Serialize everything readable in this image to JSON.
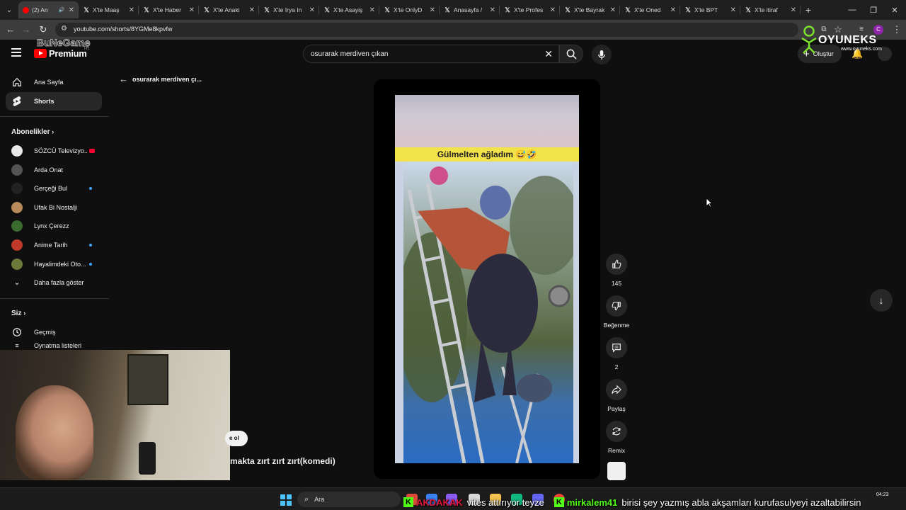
{
  "browser": {
    "tabs": [
      {
        "favicon": "youtube-icon",
        "title": "(2) An",
        "active": true,
        "audio": true
      },
      {
        "favicon": "x-icon",
        "title": "X'te Maaş"
      },
      {
        "favicon": "x-icon",
        "title": "X'te Haber"
      },
      {
        "favicon": "x-icon",
        "title": "X'te Anaki"
      },
      {
        "favicon": "x-icon",
        "title": "X'te Irya In"
      },
      {
        "favicon": "x-icon",
        "title": "X'te Asayiş"
      },
      {
        "favicon": "x-icon",
        "title": "X'te OnlyD"
      },
      {
        "favicon": "x-icon",
        "title": "Anasayfa /"
      },
      {
        "favicon": "x-icon",
        "title": "X'te Profes"
      },
      {
        "favicon": "x-icon",
        "title": "X'te Bayrak"
      },
      {
        "favicon": "x-icon",
        "title": "X'te Oned"
      },
      {
        "favicon": "x-icon",
        "title": "X'te BPT"
      },
      {
        "favicon": "x-icon",
        "title": "X'te itiraf"
      }
    ],
    "url": "youtube.com/shorts/8YGMe8kpvfw",
    "profile_initial": "C"
  },
  "header": {
    "logo_text": "Premium",
    "region": "TR",
    "search_value": "osurarak merdiven çıkan",
    "create_label": "Oluştur",
    "left_watermark": "BuNeGame"
  },
  "overlay_brand": {
    "name": "OYUNEKS",
    "url": "www.oyuneks.com"
  },
  "sidebar": {
    "main": [
      {
        "label": "Ana Sayfa",
        "icon": "home-icon"
      },
      {
        "label": "Shorts",
        "icon": "shorts-icon",
        "active": true
      }
    ],
    "subscriptions_heading": "Abonelikler",
    "subscriptions": [
      {
        "name": "SÖZCÜ Televizyo...",
        "avatar_color": "#e9e9e9",
        "live": true
      },
      {
        "name": "Arda Onat",
        "avatar_color": "#555555"
      },
      {
        "name": "Gerçeği Bul",
        "avatar_color": "#222222",
        "dot": true
      },
      {
        "name": "Ufak Bi Nostalji",
        "avatar_color": "#b98a5a"
      },
      {
        "name": "Lynx Çerezz",
        "avatar_color": "#3a6b2f"
      },
      {
        "name": "Anime Tarih",
        "avatar_color": "#c0392b",
        "dot": true
      },
      {
        "name": "Hayalimdeki Oto...",
        "avatar_color": "#6b7a3a",
        "dot": true
      }
    ],
    "show_more": "Daha fazla göster",
    "you_heading": "Siz",
    "you_items": [
      {
        "label": "Geçmiş",
        "icon": "history-icon"
      },
      {
        "label": "Oynatma listeleri",
        "icon": "playlist-icon"
      }
    ]
  },
  "shorts": {
    "back_label": "osurarak merdiven çı...",
    "video_caption": "Gülmelten ağladım 😅🤣",
    "title": "makta zırt zırt zırt(komedi)",
    "subscribe_partial": "e ol",
    "actions": {
      "like_count": "145",
      "dislike_label": "Beğenme",
      "comment_count": "2",
      "share_label": "Paylaş",
      "remix_label": "Remix"
    }
  },
  "taskbar": {
    "search_placeholder": "Ara",
    "time": "04:23"
  },
  "chat_ticker": [
    {
      "user": "AKDAKAK",
      "message": "vites attırıyor teyze",
      "user_color": "#e0183c"
    },
    {
      "user": "mirkalem41",
      "message": "birisi şey yazmış abla akşamları kurufasulyeyi azaltabilirsin",
      "user_color": "#53fc18"
    }
  ]
}
